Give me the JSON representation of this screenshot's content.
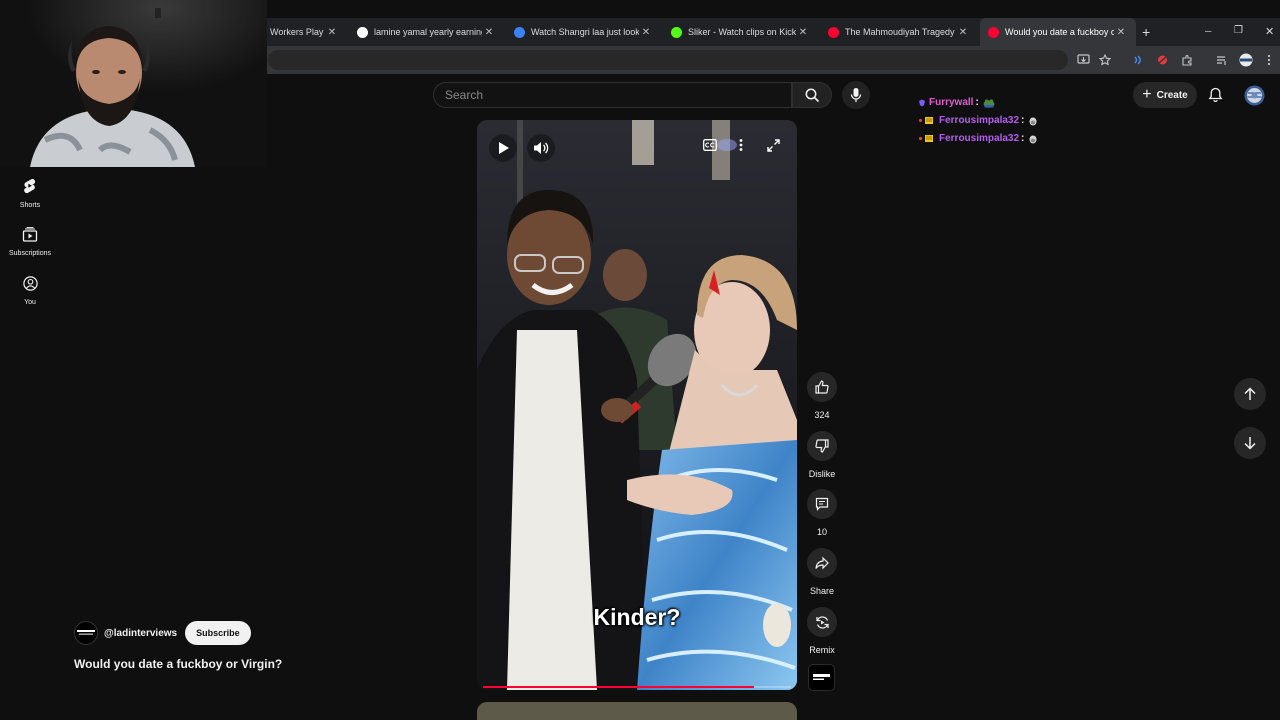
{
  "tabs": [
    {
      "title": "Workers Play Ti",
      "favicon_color": "#4a4a4a",
      "active": false
    },
    {
      "title": "lamine yamal yearly earnings -",
      "favicon_color": "#ffffff",
      "active": false
    },
    {
      "title": "Watch Shangri laa just look at t",
      "favicon_color": "#3b82f6",
      "active": false
    },
    {
      "title": "Sliker - Watch clips on Kick",
      "favicon_color": "#53fc18",
      "active": false
    },
    {
      "title": "The Mahmoudiyah Tragedy #s",
      "favicon_color": "#ff0033",
      "active": false
    },
    {
      "title": "Would you date a fuckboy or V",
      "favicon_color": "#ff0033",
      "active": true
    }
  ],
  "browser": {
    "new_tab_glyph": "+",
    "close_glyph": "✕",
    "minimize_glyph": "─",
    "restore_glyph": "❐",
    "window_close_glyph": "✕"
  },
  "sidebar": {
    "items": [
      {
        "label": "Shorts",
        "icon": "shorts-icon"
      },
      {
        "label": "Subscriptions",
        "icon": "subscriptions-icon"
      },
      {
        "label": "You",
        "icon": "you-icon"
      }
    ]
  },
  "search": {
    "placeholder": "Search"
  },
  "header": {
    "create_label": "Create"
  },
  "chat": [
    {
      "user": "Furrywall",
      "color": "#e05dd3",
      "emote": "frog-emote"
    },
    {
      "user": "Ferrousimpala32",
      "color": "#b45ef0",
      "emote": "egg-emote"
    },
    {
      "user": "Ferrousimpala32",
      "color": "#b45ef0",
      "emote": "egg-emote"
    }
  ],
  "video": {
    "caption": "Kinder?",
    "progress": 0.88
  },
  "actions": {
    "like_count": "324",
    "dislike_label": "Dislike",
    "comment_count": "10",
    "share_label": "Share",
    "remix_label": "Remix"
  },
  "channel": {
    "handle": "@ladinterviews",
    "avatar_text": "LAD INTERVIEWS",
    "subscribe_label": "Subscribe"
  },
  "video_title": "Would you date a fuckboy or Virgin?",
  "colors": {
    "accent_red": "#ff0033",
    "background": "#0f0f0f"
  }
}
